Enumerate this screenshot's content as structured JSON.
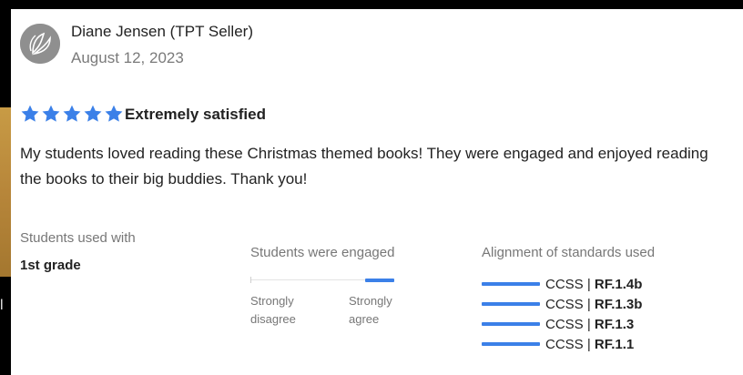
{
  "colors": {
    "accent": "#3b80e8",
    "star": "#3b80e8",
    "muted_text": "#777777",
    "avatar_bg": "#8f8f8f"
  },
  "review": {
    "reviewer_name": "Diane Jensen (TPT Seller)",
    "date": "August 12, 2023",
    "rating": 5,
    "rating_max": 5,
    "rating_label": "Extremely satisfied",
    "text": "My students loved reading these Christmas themed books! They were engaged and enjoyed reading the books to their big buddies. Thank you!"
  },
  "details": {
    "students_used_with_label": "Students used with",
    "students_used_with_value": "1st grade",
    "engaged": {
      "label": "Students were engaged",
      "level_fraction": 1.0,
      "low_label": "Strongly disagree",
      "high_label": "Strongly agree"
    },
    "alignment": {
      "label": "Alignment of standards used",
      "standards": [
        {
          "prefix": "CCSS | ",
          "code": "RF.1.4b"
        },
        {
          "prefix": "CCSS | ",
          "code": "RF.1.3b"
        },
        {
          "prefix": "CCSS | ",
          "code": "RF.1.3"
        },
        {
          "prefix": "CCSS | ",
          "code": "RF.1.1"
        }
      ]
    }
  },
  "background": {
    "partial_glyph": "l"
  },
  "icons": {
    "avatar": "store-logo-icon",
    "star": "star-icon"
  }
}
